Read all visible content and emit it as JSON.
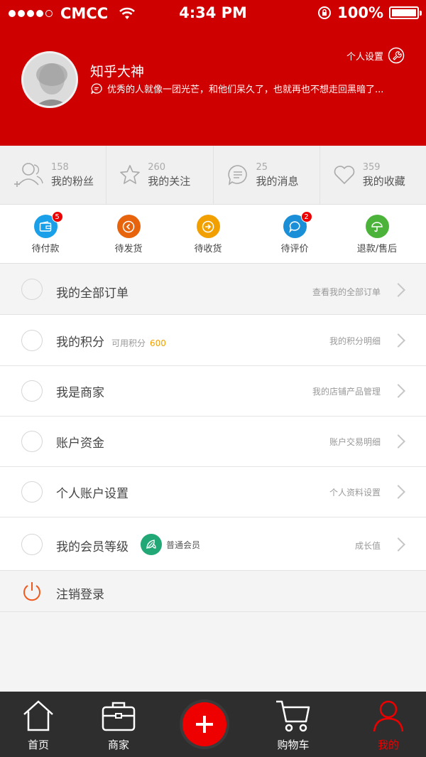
{
  "status_bar": {
    "carrier": "CMCC",
    "time": "4:34 PM",
    "battery": "100%"
  },
  "profile": {
    "name": "知乎大神",
    "signature": "优秀的人就像一团光芒，和他们呆久了，也就再也不想走回黑暗了...",
    "settings_label": "个人设置"
  },
  "stats": [
    {
      "count": "158",
      "label": "我的粉丝",
      "icon": "fans-icon"
    },
    {
      "count": "260",
      "label": "我的关注",
      "icon": "star-icon"
    },
    {
      "count": "25",
      "label": "我的消息",
      "icon": "message-icon"
    },
    {
      "count": "359",
      "label": "我的收藏",
      "icon": "heart-icon"
    }
  ],
  "orders": [
    {
      "label": "待付款",
      "badge": "5",
      "color": "#1aa0e8",
      "icon": "wallet-icon"
    },
    {
      "label": "待发货",
      "badge": "",
      "color": "#e8640c",
      "icon": "arrow-left-circle-icon"
    },
    {
      "label": "待收货",
      "badge": "",
      "color": "#f2a000",
      "icon": "arrow-right-circle-icon"
    },
    {
      "label": "待评价",
      "badge": "2",
      "color": "#1a8fd8",
      "icon": "comment-icon"
    },
    {
      "label": "退款/售后",
      "badge": "",
      "color": "#4cb33a",
      "icon": "umbrella-icon"
    }
  ],
  "menu": [
    {
      "title": "我的全部订单",
      "hint": "查看我的全部订单"
    },
    {
      "title": "我的积分",
      "hint": "我的积分明细",
      "extra_label": "可用积分",
      "extra_value": "600"
    },
    {
      "title": "我是商家",
      "hint": "我的店铺产品管理"
    },
    {
      "title": "账户资金",
      "hint": "账户交易明细"
    },
    {
      "title": "个人账户设置",
      "hint": "个人资料设置"
    },
    {
      "title": "我的会员等级",
      "hint": "成长值",
      "member_level": "普通会员"
    }
  ],
  "logout_label": "注销登录",
  "tabs": [
    {
      "label": "首页",
      "icon": "home-icon"
    },
    {
      "label": "商家",
      "icon": "briefcase-icon"
    },
    {
      "label": "购物车",
      "icon": "cart-icon"
    },
    {
      "label": "我的",
      "icon": "user-icon",
      "active": true
    }
  ],
  "colors": {
    "brand_red": "#cf0000",
    "accent_orange": "#f0a000",
    "member_green": "#22a876"
  }
}
